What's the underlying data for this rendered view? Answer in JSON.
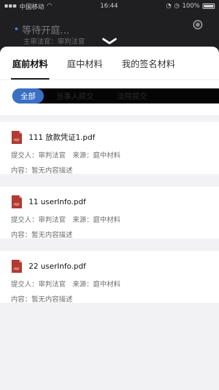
{
  "status_bar": {
    "carrier": "中国移动",
    "time": "16:44",
    "battery": "100%"
  },
  "background": {
    "title": "等待开庭...",
    "subtitle": "主审法官：审判法官"
  },
  "tabs": [
    {
      "label": "庭前材料",
      "active": true
    },
    {
      "label": "庭中材料",
      "active": false
    },
    {
      "label": "我的签名材料",
      "active": false
    }
  ],
  "filters": [
    {
      "label": "全部",
      "active": true
    },
    {
      "label": "当事人提交",
      "active": false
    },
    {
      "label": "法院提交",
      "active": false
    }
  ],
  "documents": [
    {
      "file_name": "111 放款凭证1.pdf",
      "submitter_label": "提交人：",
      "submitter": "审判法官",
      "source_label": "来源：",
      "source": "庭中材料",
      "content_label": "内容：",
      "content": "暂无内容描述"
    },
    {
      "file_name": "11 userInfo.pdf",
      "submitter_label": "提交人：",
      "submitter": "审判法官",
      "source_label": "来源：",
      "source": "庭中材料",
      "content_label": "内容：",
      "content": "暂无内容描述"
    },
    {
      "file_name": "22 userInfo.pdf",
      "submitter_label": "提交人：",
      "submitter": "审判法官",
      "source_label": "来源：",
      "source": "庭中材料",
      "content_label": "内容：",
      "content": "暂无内容描述"
    }
  ],
  "icons": {
    "pdf_badge": "PDF",
    "pdf_color": "#b23a32",
    "accent": "#3a6fc4"
  }
}
